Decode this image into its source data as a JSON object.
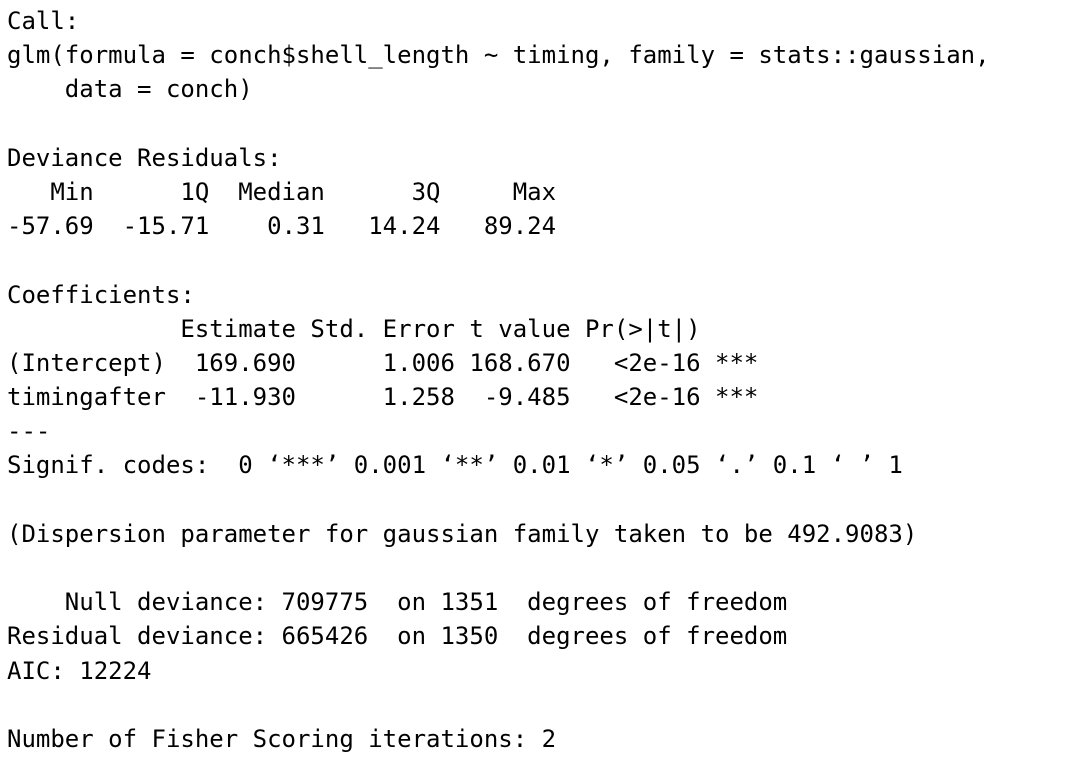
{
  "console": {
    "lines": [
      "Call:",
      "glm(formula = conch$shell_length ~ timing, family = stats::gaussian,",
      "    data = conch)",
      "",
      "Deviance Residuals:",
      "   Min      1Q  Median      3Q     Max",
      "-57.69  -15.71    0.31   14.24   89.24",
      "",
      "Coefficients:",
      "            Estimate Std. Error t value Pr(>|t|)",
      "(Intercept)  169.690      1.006 168.670   <2e-16 ***",
      "timingafter  -11.930      1.258  -9.485   <2e-16 ***",
      "---",
      "Signif. codes:  0 ‘***’ 0.001 ‘**’ 0.01 ‘*’ 0.05 ‘.’ 0.1 ‘ ’ 1",
      "",
      "(Dispersion parameter for gaussian family taken to be 492.9083)",
      "",
      "    Null deviance: 709775  on 1351  degrees of freedom",
      "Residual deviance: 665426  on 1350  degrees of freedom",
      "AIC: 12224",
      "",
      "Number of Fisher Scoring iterations: 2"
    ]
  }
}
